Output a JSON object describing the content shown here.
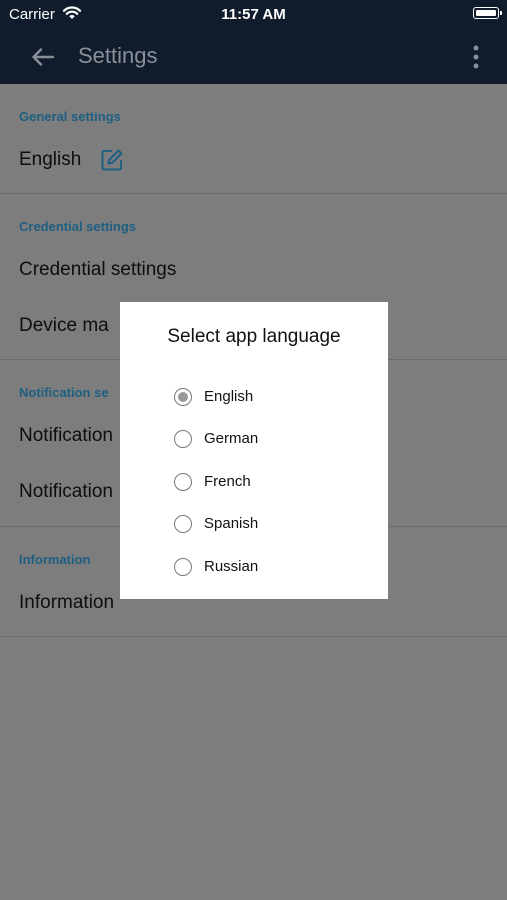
{
  "status_bar": {
    "carrier": "Carrier",
    "time": "11:57 AM"
  },
  "app_bar": {
    "title": "Settings"
  },
  "sections": {
    "general": {
      "header": "General settings",
      "items": [
        "English"
      ]
    },
    "credential": {
      "header": "Credential settings",
      "items": [
        "Credential settings",
        "Device ma"
      ]
    },
    "notification": {
      "header": "Notification se",
      "items": [
        "Notification",
        "Notification"
      ]
    },
    "information": {
      "header": "Information",
      "items": [
        "Information"
      ]
    }
  },
  "dialog": {
    "title": "Select app language",
    "options": [
      "English",
      "German",
      "French",
      "Spanish",
      "Russian"
    ],
    "selected": "English"
  },
  "colors": {
    "app_bar": "#101c2b",
    "scrim": "#7d7d7d",
    "section_header": "#1e5f82",
    "edit_icon": "#1e5f82"
  },
  "icons": {
    "back": "arrow-left-icon",
    "more": "more-vertical-icon",
    "edit": "edit-icon",
    "wifi": "wifi-icon",
    "battery": "battery-icon"
  }
}
